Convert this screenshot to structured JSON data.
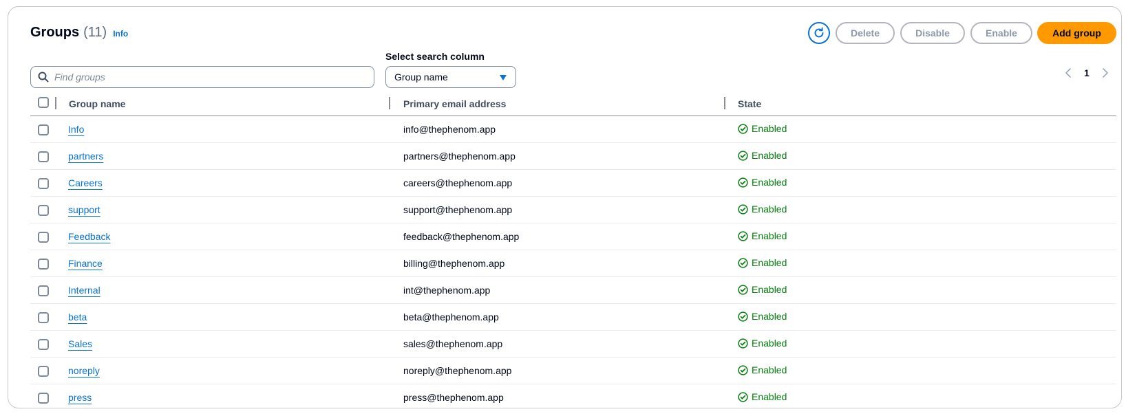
{
  "header": {
    "title": "Groups",
    "count": "(11)",
    "info_link": "Info"
  },
  "toolbar": {
    "refresh_icon": "refresh-icon",
    "delete_label": "Delete",
    "disable_label": "Disable",
    "enable_label": "Enable",
    "add_label": "Add group"
  },
  "search": {
    "placeholder": "Find groups",
    "value": ""
  },
  "search_column": {
    "label": "Select search column",
    "selected": "Group name"
  },
  "pagination": {
    "current_page": "1"
  },
  "table": {
    "columns": [
      "Group name",
      "Primary email address",
      "State"
    ],
    "rows": [
      {
        "name": "Info",
        "email": "info@thephenom.app",
        "state": "Enabled"
      },
      {
        "name": "partners",
        "email": "partners@thephenom.app",
        "state": "Enabled"
      },
      {
        "name": "Careers",
        "email": "careers@thephenom.app",
        "state": "Enabled"
      },
      {
        "name": "support",
        "email": "support@thephenom.app",
        "state": "Enabled"
      },
      {
        "name": "Feedback",
        "email": "feedback@thephenom.app",
        "state": "Enabled"
      },
      {
        "name": "Finance",
        "email": "billing@thephenom.app",
        "state": "Enabled"
      },
      {
        "name": "Internal",
        "email": "int@thephenom.app",
        "state": "Enabled"
      },
      {
        "name": "beta",
        "email": "beta@thephenom.app",
        "state": "Enabled"
      },
      {
        "name": "Sales",
        "email": "sales@thephenom.app",
        "state": "Enabled"
      },
      {
        "name": "noreply",
        "email": "noreply@thephenom.app",
        "state": "Enabled"
      },
      {
        "name": "press",
        "email": "press@thephenom.app",
        "state": "Enabled"
      }
    ]
  },
  "colors": {
    "accent": "#0972d3",
    "primary_button": "#ff9900",
    "success": "#037f0c"
  }
}
